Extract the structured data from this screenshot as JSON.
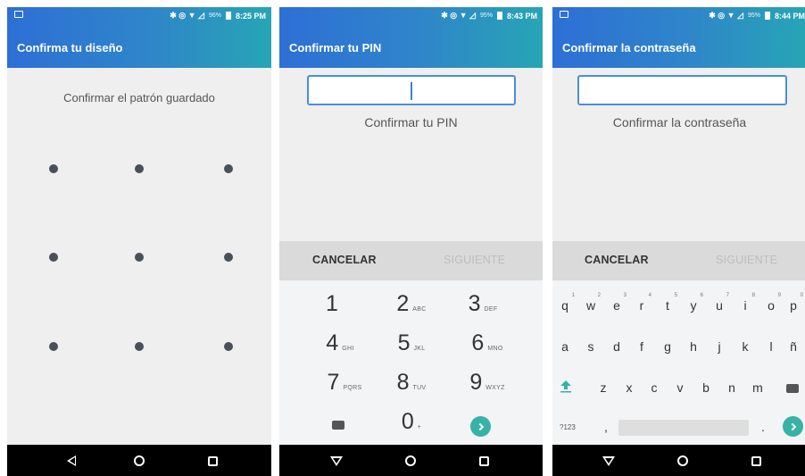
{
  "screens": [
    {
      "status": {
        "icons": "✱ ◎ ▼ ◿",
        "battery": "96%",
        "time": "8:25 PM"
      },
      "title": "Confirma tu diseño",
      "prompt": "Confirmar el patrón guardado"
    },
    {
      "status": {
        "icons": "✱ ◎ ▼ ◿",
        "battery": "95%",
        "time": "8:43 PM"
      },
      "title": "Confirmar tu PIN",
      "prompt": "Confirmar tu PIN",
      "actions": {
        "cancel": "CANCELAR",
        "next": "SIGUIENTE"
      },
      "keys": [
        {
          "d": "1",
          "l": ""
        },
        {
          "d": "2",
          "l": "ABC"
        },
        {
          "d": "3",
          "l": "DEF"
        },
        {
          "d": "4",
          "l": "GHI"
        },
        {
          "d": "5",
          "l": "JKL"
        },
        {
          "d": "6",
          "l": "MNO"
        },
        {
          "d": "7",
          "l": "PQRS"
        },
        {
          "d": "8",
          "l": "TUV"
        },
        {
          "d": "9",
          "l": "WXYZ"
        },
        {
          "d": "0",
          "l": "+"
        }
      ]
    },
    {
      "status": {
        "icons": "✱ ◎ ▼ ◿",
        "battery": "95%",
        "time": "8:44 PM"
      },
      "title": "Confirmar la contraseña",
      "prompt": "Confirmar la contraseña",
      "actions": {
        "cancel": "CANCELAR",
        "next": "SIGUIENTE"
      },
      "row1": [
        "q",
        "w",
        "e",
        "r",
        "t",
        "y",
        "u",
        "i",
        "o",
        "p"
      ],
      "row1_hints": [
        "1",
        "2",
        "3",
        "4",
        "5",
        "6",
        "7",
        "8",
        "9",
        "0"
      ],
      "row2": [
        "a",
        "s",
        "d",
        "f",
        "g",
        "h",
        "j",
        "k",
        "l",
        "ñ"
      ],
      "row3": [
        "z",
        "x",
        "c",
        "v",
        "b",
        "n",
        "m"
      ],
      "row4": {
        "sym": "?123",
        "comma": ",",
        "period": "."
      }
    }
  ]
}
